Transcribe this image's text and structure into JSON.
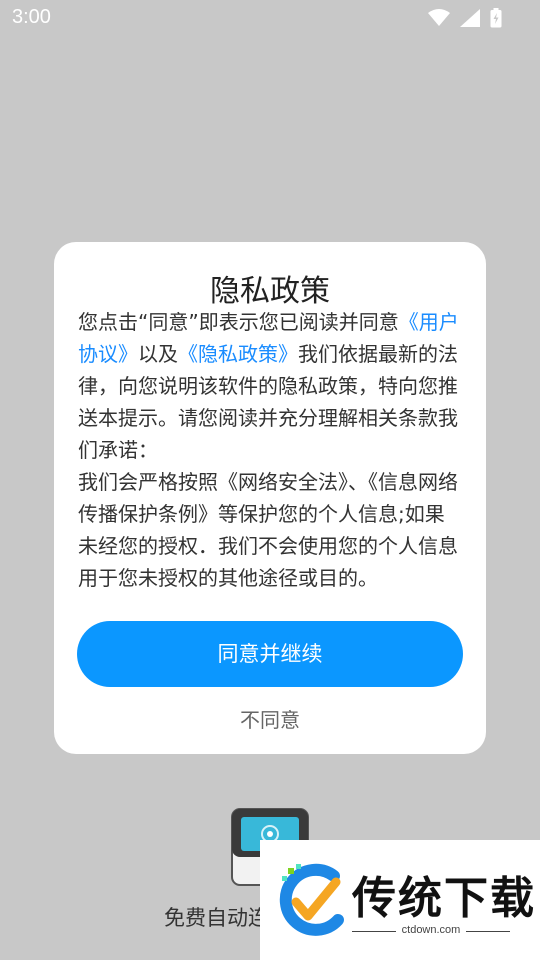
{
  "status_bar": {
    "time": "3:00",
    "icons": [
      "wifi-icon",
      "signal-icon",
      "battery-icon"
    ]
  },
  "dialog": {
    "title": "隐私政策",
    "body_segments": [
      {
        "text": "您点击“同意”即表示您已阅读并同意",
        "link": false
      },
      {
        "text": "《用户协议》",
        "link": true
      },
      {
        "text": "以及",
        "link": false
      },
      {
        "text": "《隐私政策》",
        "link": true
      },
      {
        "text": "我们依据最新的法律，向您说明该软件的隐私政策，特向您推送本提示。请您阅读并充分理解相关条款我们承诺：",
        "link": false
      }
    ],
    "body_para2": "我们会严格按照《网络安全法》、《信息网络传播保护条例》等保护您的个人信息;如果未经您的授权．我们不会使用您的个人信息用于您未授权的其他途径或目的。",
    "agree_label": "同意并继续",
    "disagree_label": "不同意"
  },
  "background": {
    "bottom_text": "免费自动连"
  },
  "watermark": {
    "name": "传统下载",
    "url": "ctdown.com"
  },
  "colors": {
    "accent": "#0b97ff",
    "link": "#1a8cff",
    "overlay": "#c8c8c8"
  }
}
